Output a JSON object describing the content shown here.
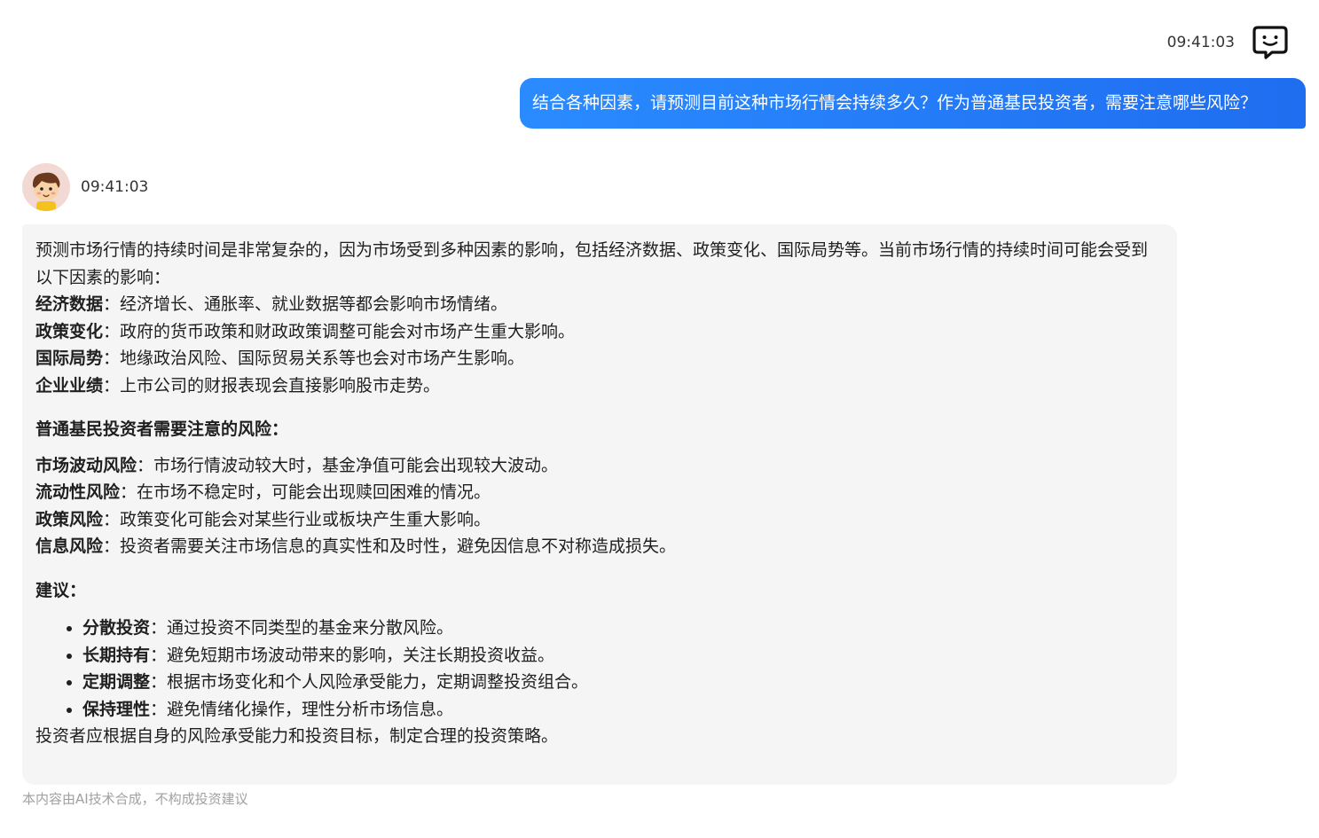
{
  "user_message": {
    "time": "09:41:03",
    "text": "结合各种因素，请预测目前这种市场行情会持续多久？作为普通基民投资者，需要注意哪些风险？",
    "icon": "chat-bubble-smile-icon"
  },
  "bot_message": {
    "time": "09:41:03",
    "avatar": "cartoon-boy-avatar",
    "intro": "预测市场行情的持续时间是非常复杂的，因为市场受到多种因素的影响，包括经济数据、政策变化、国际局势等。当前市场行情的持续时间可能会受到以下因素的影响：",
    "factors": [
      {
        "term": "经济数据",
        "sep": "：",
        "desc": "经济增长、通胀率、就业数据等都会影响市场情绪。"
      },
      {
        "term": "政策变化",
        "sep": "：",
        "desc": "政府的货币政策和财政政策调整可能会对市场产生重大影响。"
      },
      {
        "term": "国际局势",
        "sep": "：",
        "desc": "地缘政治风险、国际贸易关系等也会对市场产生影响。"
      },
      {
        "term": "企业业绩",
        "sep": "：",
        "desc": "上市公司的财报表现会直接影响股市走势。"
      }
    ],
    "risk_heading": "普通基民投资者需要注意的风险：",
    "risks": [
      {
        "term": "市场波动风险",
        "sep": "：",
        "desc": "市场行情波动较大时，基金净值可能会出现较大波动。"
      },
      {
        "term": "流动性风险",
        "sep": "：",
        "desc": "在市场不稳定时，可能会出现赎回困难的情况。"
      },
      {
        "term": "政策风险",
        "sep": "：",
        "desc": "政策变化可能会对某些行业或板块产生重大影响。"
      },
      {
        "term": "信息风险",
        "sep": "：",
        "desc": "投资者需要关注市场信息的真实性和及时性，避免因信息不对称造成损失。"
      }
    ],
    "advice_heading": "建议：",
    "advice": [
      {
        "term": "分散投资",
        "sep": "：",
        "desc": "通过投资不同类型的基金来分散风险。"
      },
      {
        "term": "长期持有",
        "sep": "：",
        "desc": "避免短期市场波动带来的影响，关注长期投资收益。"
      },
      {
        "term": "定期调整",
        "sep": "：",
        "desc": "根据市场变化和个人风险承受能力，定期调整投资组合。"
      },
      {
        "term": "保持理性",
        "sep": "：",
        "desc": "避免情绪化操作，理性分析市场信息。"
      }
    ],
    "closing": "投资者应根据自身的风险承受能力和投资目标，制定合理的投资策略。"
  },
  "disclaimer": "本内容由AI技术合成，不构成投资建议",
  "colors": {
    "user_bubble_start": "#2a8bff",
    "user_bubble_end": "#1f6df0",
    "bot_bubble_bg": "#f5f5f5",
    "disclaimer_text": "#a0a0a0"
  }
}
